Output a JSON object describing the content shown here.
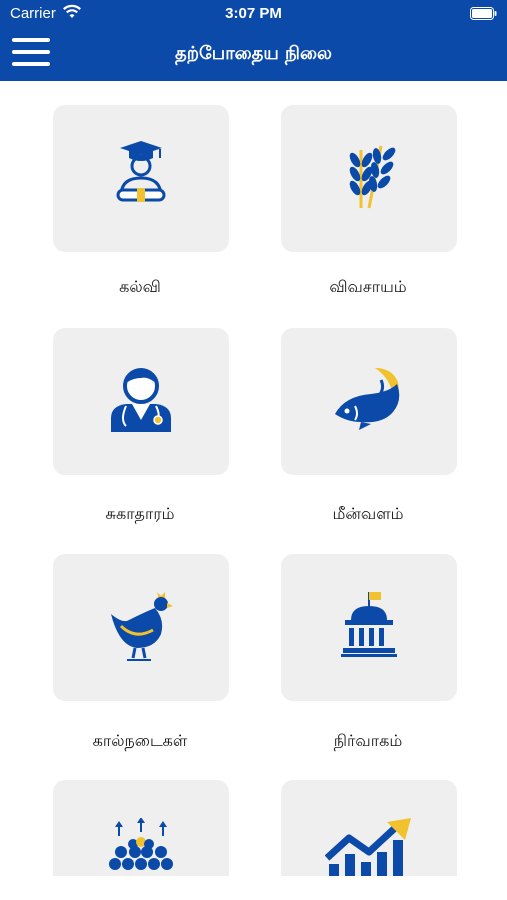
{
  "status_bar": {
    "carrier": "Carrier",
    "time": "3:07 PM"
  },
  "header": {
    "title": "தற்போதைய நிலை",
    "menu_icon": "hamburger-menu-icon"
  },
  "colors": {
    "brand_blue": "#0B4AA8",
    "tile_bg": "#EFEFEF",
    "accent_yellow": "#F2C12E"
  },
  "categories": [
    {
      "label": "கல்வி",
      "icon": "graduate-icon"
    },
    {
      "label": "விவசாயம்",
      "icon": "wheat-icon"
    },
    {
      "label": "சுகாதாரம்",
      "icon": "doctor-icon"
    },
    {
      "label": "மீன்வளம்",
      "icon": "fish-icon"
    },
    {
      "label": "கால்நடைகள்",
      "icon": "hen-icon"
    },
    {
      "label": "நிர்வாகம்",
      "icon": "government-building-icon"
    },
    {
      "label": "",
      "icon": "population-growth-icon"
    },
    {
      "label": "",
      "icon": "growth-chart-icon"
    }
  ]
}
